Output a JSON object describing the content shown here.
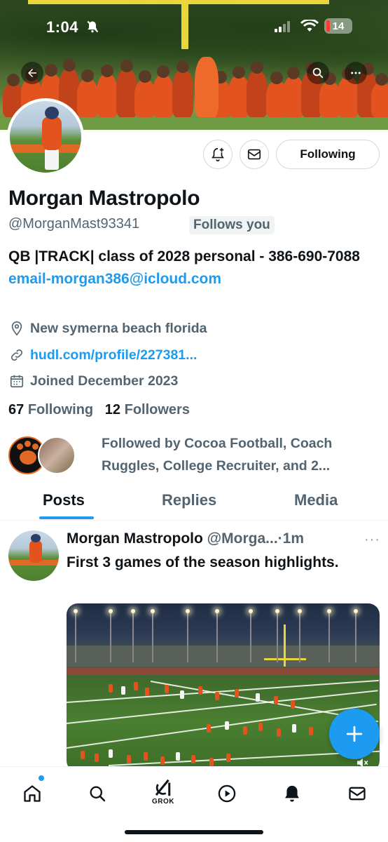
{
  "status_bar": {
    "time": "1:04",
    "battery": "14"
  },
  "profile": {
    "name": "Morgan Mastropolo",
    "handle": "@MorganMast93341",
    "follows_you": "Follows you",
    "following_button": "Following",
    "bio_text": "QB |TRACK| class of 2028 personal - 386-690-7088 ",
    "bio_link": "email-morgan386@icloud.com",
    "location": "New symerna beach florida",
    "website": "hudl.com/profile/227381...",
    "joined": "Joined December 2023",
    "following_count": "67",
    "following_label": "Following",
    "followers_count": "12",
    "followers_label": "Followers",
    "followed_by": "Followed by Cocoa Football, Coach Ruggles, College Recruiter, and 2..."
  },
  "tabs": [
    {
      "label": "Posts",
      "active": true
    },
    {
      "label": "Replies",
      "active": false
    },
    {
      "label": "Media",
      "active": false
    }
  ],
  "post": {
    "author": "Morgan Mastropolo",
    "handle_time": "@Morga...",
    "time": "1m",
    "text": "First 3 games of the season highlights.",
    "more": "···"
  },
  "nav": {
    "grok_label": "GROK",
    "items": [
      "home-icon",
      "search-icon",
      "grok-icon",
      "video-icon",
      "bell-icon",
      "mail-icon"
    ]
  },
  "colors": {
    "accent": "#1d9bf0",
    "text": "#0f1419",
    "secondary": "#536471",
    "team_orange": "#e2531f"
  }
}
